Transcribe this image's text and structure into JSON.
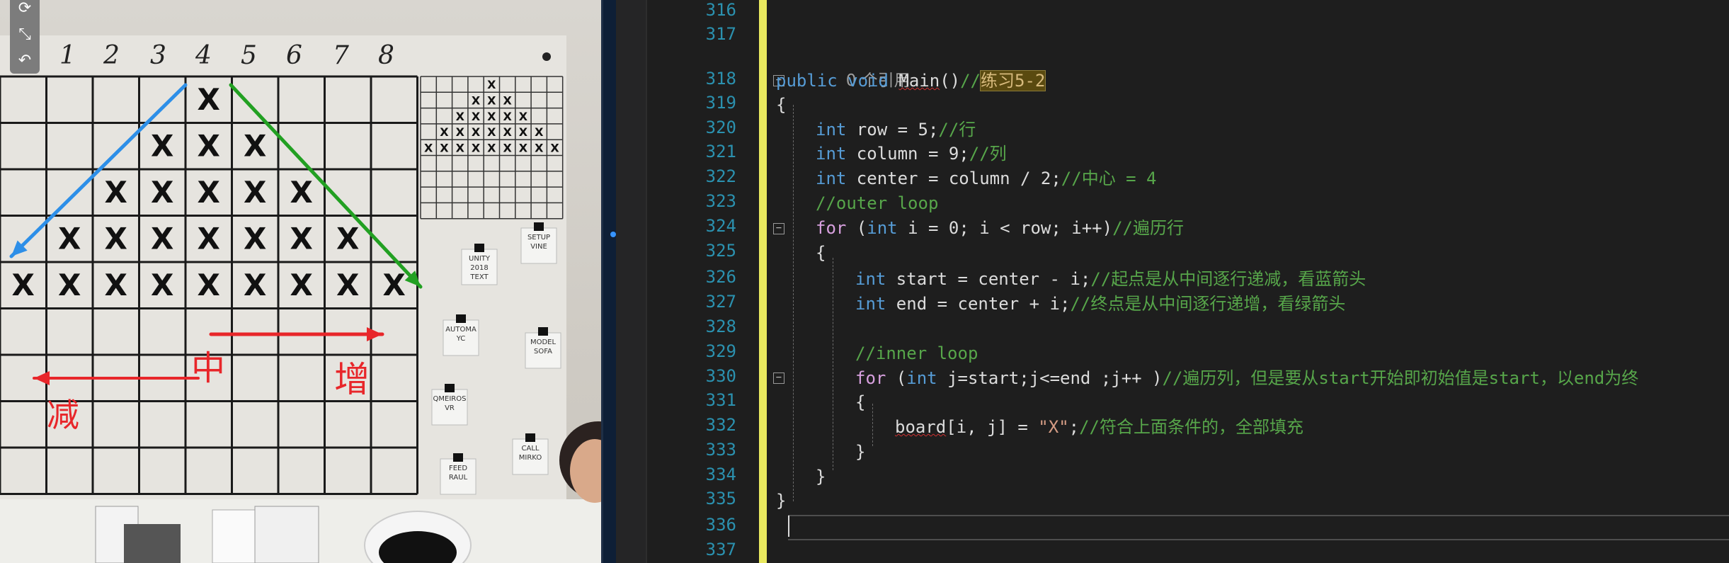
{
  "video": {
    "toolbar": [
      {
        "name": "refresh-icon",
        "glyph": "⟳"
      },
      {
        "name": "fullscreen-icon",
        "glyph": "⤡"
      },
      {
        "name": "undo-icon",
        "glyph": "↶"
      }
    ],
    "column_numbers": [
      "1",
      "2",
      "3",
      "4",
      "5",
      "6",
      "7",
      "8"
    ],
    "big_grid_rows": [
      [
        0,
        0,
        0,
        0,
        1,
        0,
        0,
        0,
        0
      ],
      [
        0,
        0,
        0,
        1,
        1,
        1,
        0,
        0,
        0
      ],
      [
        0,
        0,
        1,
        1,
        1,
        1,
        1,
        0,
        0
      ],
      [
        0,
        1,
        1,
        1,
        1,
        1,
        1,
        1,
        0
      ],
      [
        1,
        1,
        1,
        1,
        1,
        1,
        1,
        1,
        1
      ],
      [
        0,
        0,
        0,
        0,
        0,
        0,
        0,
        0,
        0
      ],
      [
        0,
        0,
        0,
        0,
        0,
        0,
        0,
        0,
        0
      ],
      [
        0,
        0,
        0,
        0,
        0,
        0,
        0,
        0,
        0
      ],
      [
        0,
        0,
        0,
        0,
        0,
        0,
        0,
        0,
        0
      ]
    ],
    "cell_mark": "X",
    "labels": {
      "center": "中",
      "increase": "增",
      "decrease": "减"
    },
    "colors": {
      "blue_arrow": "#2d8fe8",
      "green_arrow": "#22a022",
      "red": "#e8262a"
    },
    "notes": [
      {
        "lines": [
          "UNITY",
          "2018",
          "TEXT"
        ]
      },
      {
        "lines": [
          "SETUP",
          "VINE"
        ]
      },
      {
        "lines": [
          "AUTOMA",
          "YC"
        ]
      },
      {
        "lines": [
          "MODEL",
          "SOFA"
        ]
      },
      {
        "lines": [
          "QMEIROS",
          "VR"
        ]
      },
      {
        "lines": [
          "CALL",
          "MIRKO"
        ]
      },
      {
        "lines": [
          "FEED",
          "RAUL"
        ]
      }
    ]
  },
  "editor": {
    "colors": {
      "line_number": "#2b91af",
      "keyword": "#569cd6",
      "control": "#d8a0df",
      "comment": "#57a64a",
      "string": "#d69d85",
      "change_bar": "#e8e85f"
    },
    "line_numbers": [
      "316",
      "317",
      "318",
      "319",
      "320",
      "321",
      "322",
      "323",
      "324",
      "325",
      "326",
      "327",
      "328",
      "329",
      "330",
      "331",
      "332",
      "333",
      "334",
      "335",
      "336",
      "337"
    ],
    "references_label": "0 个引用",
    "code": {
      "l318": {
        "kw": "public",
        "kw2": "void",
        "name": "Main",
        "paren": "()",
        "comment_prefix": "//",
        "comment_hl": "练习5-2"
      },
      "l319": "{",
      "l320": {
        "kw": "int",
        "rest": " row = 5;",
        "comment": "//行"
      },
      "l321": {
        "kw": "int",
        "rest": " column = 9;",
        "comment": "//列"
      },
      "l322": {
        "kw": "int",
        "rest": " center = column / 2;",
        "comment": "//中心 = 4"
      },
      "l323": {
        "comment": "//outer loop"
      },
      "l324": {
        "ctl": "for",
        "p1": " (",
        "kw": "int",
        "rest": " i = 0; i < row; i++)",
        "comment": "//遍历行"
      },
      "l325": "{",
      "l326": {
        "kw": "int",
        "rest": " start = center - i;",
        "comment": "//起点是从中间逐行递减，看蓝箭头"
      },
      "l327": {
        "kw": "int",
        "rest": " end = center + i;",
        "comment": "//终点是从中间逐行递增，看绿箭头"
      },
      "l329": {
        "comment": "//inner loop"
      },
      "l330": {
        "ctl": "for",
        "p1": " (",
        "kw": "int",
        "rest": " j=start;j<=end ;j++ )",
        "comment": "//遍历列，但是要从start开始即初始值是start，以end为终"
      },
      "l331": "{",
      "l332": {
        "name": "board",
        "rest": "[i, j] = ",
        "str": "\"X\"",
        "rest2": ";",
        "comment": "//符合上面条件的，全部填充"
      },
      "l333": "}",
      "l334": "}",
      "l335": "}"
    }
  }
}
